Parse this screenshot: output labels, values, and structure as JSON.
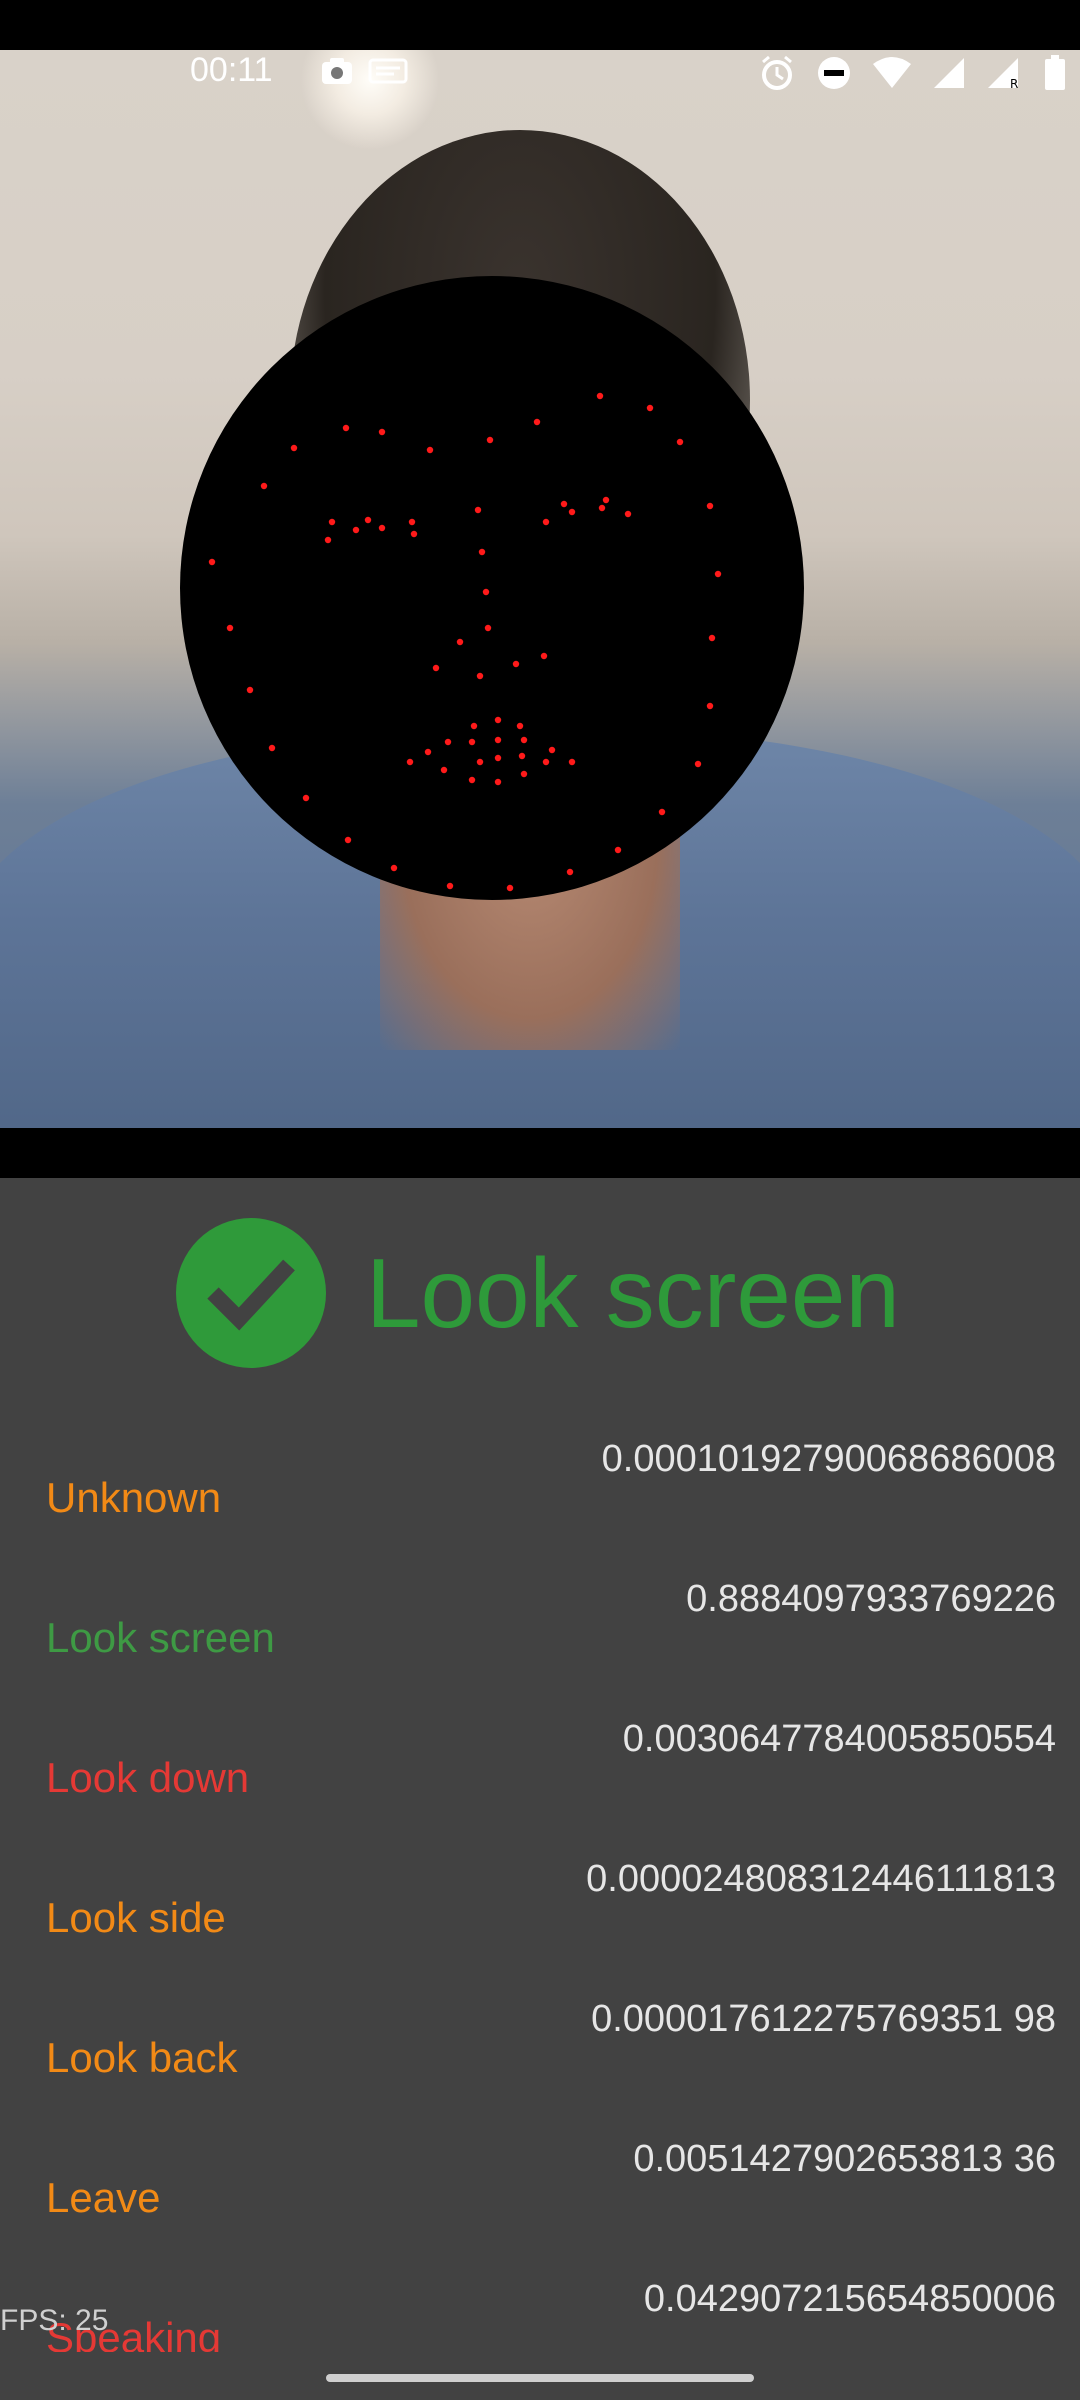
{
  "status_bar": {
    "time": "00:11",
    "left_icons": [
      "camera-icon",
      "notification-icon"
    ],
    "right_icons": [
      "alarm-icon",
      "dnd-icon",
      "wifi-icon",
      "signal-icon",
      "signal-roaming-icon",
      "battery-icon"
    ]
  },
  "camera": {
    "mask_color": "#000000",
    "landmark_color": "#ff1a1a"
  },
  "result": {
    "label": "Look screen",
    "icon": "checkmark-icon",
    "color": "#2e9a3a"
  },
  "classes": [
    {
      "label": "Unknown",
      "value": "0.00010192790068686008",
      "color": "#f28a16"
    },
    {
      "label": "Look screen",
      "value": "0.8884097933769226",
      "color": "#3e9a44"
    },
    {
      "label": "Look down",
      "value": "0.0030647784005850554",
      "color": "#e53935"
    },
    {
      "label": "Look side",
      "value": "0.000024808312446111813",
      "color": "#f28a16"
    },
    {
      "label": "Look back",
      "value": "0.000017612275769351 98",
      "color": "#f28a16"
    },
    {
      "label": "Leave",
      "value": "0.0051427902653813 36",
      "color": "#f28a16"
    },
    {
      "label": "Speaking",
      "value": "0.042907215654850006",
      "color": "#e53935"
    }
  ],
  "fps": "FPS: 25"
}
